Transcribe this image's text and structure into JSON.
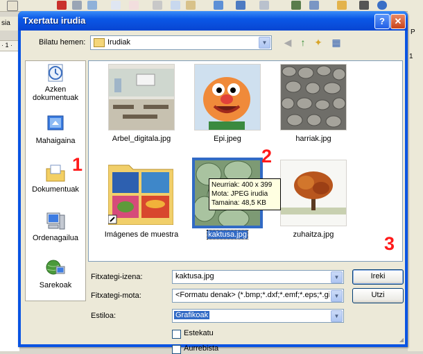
{
  "background_app": {
    "left_text_1": "sia",
    "left_text_2": "· 1 ·",
    "right_text_1": "P",
    "right_text_2": "1"
  },
  "dialog": {
    "title": "Txertatu irudia",
    "help_label": "?",
    "close_label": "✕"
  },
  "look_in": {
    "label": "Bilatu hemen:",
    "value": "Irudiak"
  },
  "places": [
    {
      "label": "Azken dokumentuak",
      "icon": "recent-documents-icon"
    },
    {
      "label": "Mahaigaina",
      "icon": "desktop-icon"
    },
    {
      "label": "Dokumentuak",
      "icon": "my-documents-icon"
    },
    {
      "label": "Ordenagailua",
      "icon": "my-computer-icon"
    },
    {
      "label": "Sarekoak",
      "icon": "network-places-icon"
    }
  ],
  "files": [
    {
      "name": "Arbel_digitala.jpg"
    },
    {
      "name": "Epi.jpeg"
    },
    {
      "name": "harriak.jpg"
    },
    {
      "name": "Imágenes de muestra"
    },
    {
      "name": "kaktusa.jpg",
      "selected": true
    },
    {
      "name": "zuhaitza.jpg"
    }
  ],
  "tooltip": {
    "line1": "Neurriak: 400 x 399",
    "line2": "Mota: JPEG irudia",
    "line3": "Tamaina: 48,5 KB"
  },
  "fields": {
    "filename_label": "Fitxategi-izena:",
    "filename_value": "kaktusa.jpg",
    "filetype_label": "Fitxategi-mota:",
    "filetype_value": "<Formatu denak> (*.bmp;*.dxf;*.emf;*.eps;*.gif;*.",
    "style_label": "Estiloa:",
    "style_value": "Grafikoak"
  },
  "buttons": {
    "open": "Ireki",
    "cancel": "Utzi"
  },
  "checkboxes": {
    "link": "Estekatu",
    "preview": "Aurrebista"
  },
  "annotations": {
    "step1": "1",
    "step2": "2",
    "step3": "3"
  },
  "colors": {
    "title_bar": "#0a54e3",
    "selection": "#316ac5",
    "annotation": "#ff1a1a"
  }
}
